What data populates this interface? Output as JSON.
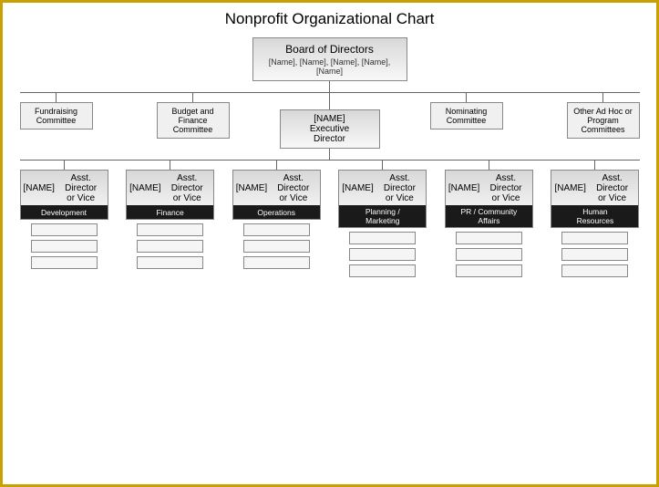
{
  "title": "Nonprofit Organizational Chart",
  "board": {
    "title": "Board of Directors",
    "names": "[Name], [Name], [Name], [Name], [Name]"
  },
  "committees": [
    {
      "label": "Fundraising\nCommittee"
    },
    {
      "label": "Budget and\nFinance\nCommittee"
    },
    {
      "label": "Nominating\nCommittee"
    },
    {
      "label": "Other Ad Hoc or\nProgram\nCommittees"
    }
  ],
  "executive": {
    "name": "[NAME]",
    "title": "Executive\nDirector"
  },
  "directors": [
    {
      "name": "[NAME]",
      "role": "Asst. Director\nor Vice",
      "dept": "Development"
    },
    {
      "name": "[NAME]",
      "role": "Asst. Director\nor Vice",
      "dept": "Finance"
    },
    {
      "name": "[NAME]",
      "role": "Asst. Director\nor Vice",
      "dept": "Operations"
    },
    {
      "name": "[NAME]",
      "role": "Asst. Director\nor Vice",
      "dept": "Planning /\nMarketing"
    },
    {
      "name": "[NAME]",
      "role": "Asst. Director\nor Vice",
      "dept": "PR / Community\nAffairs"
    },
    {
      "name": "[NAME]",
      "role": "Asst. Director\nor Vice",
      "dept": "Human\nResources"
    }
  ]
}
